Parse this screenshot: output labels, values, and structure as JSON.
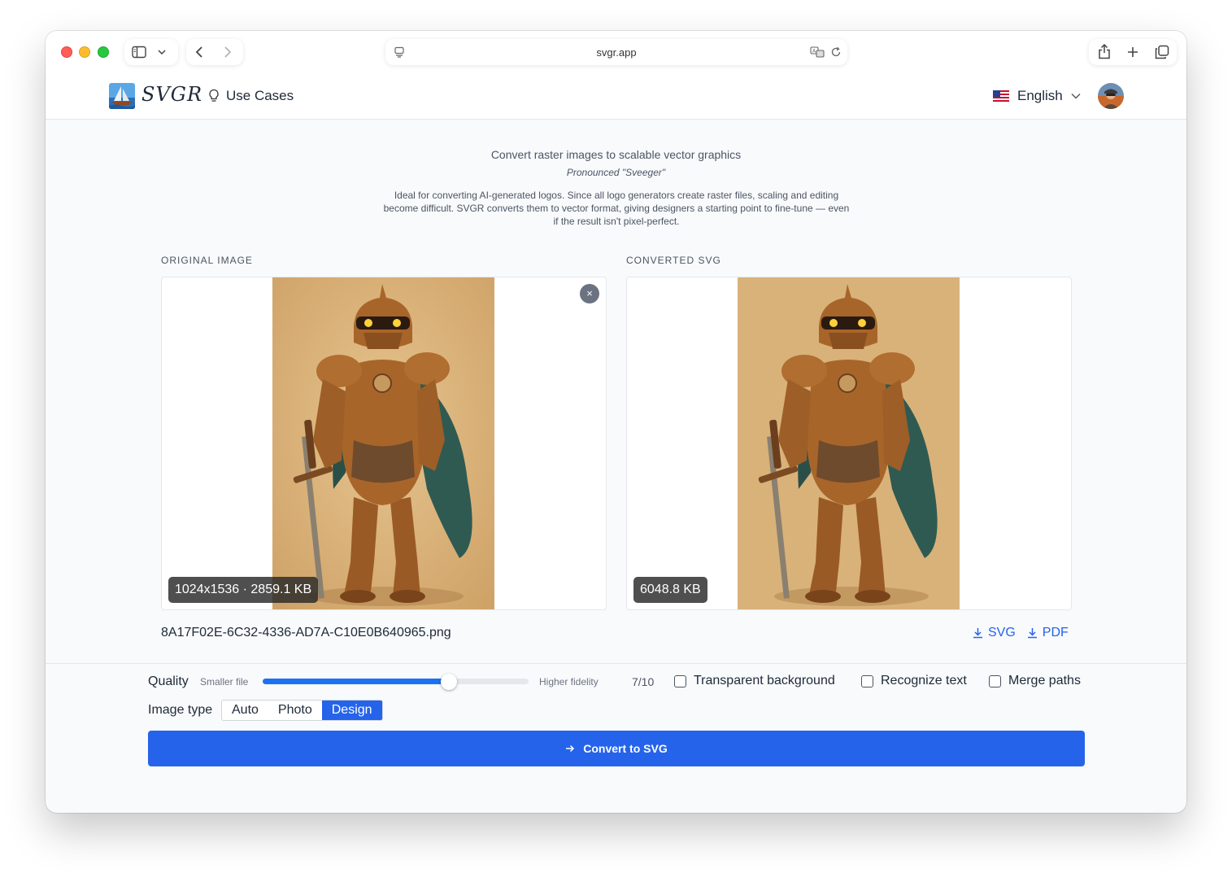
{
  "browser": {
    "url": "svgr.app"
  },
  "header": {
    "logo_text": "SVGR",
    "use_cases": "Use Cases",
    "language": "English"
  },
  "intro": {
    "title": "Convert raster images to scalable vector graphics",
    "pronounced": "Pronounced \"Sveeger\"",
    "description": "Ideal for converting AI-generated logos. Since all logo generators create raster files, scaling and editing become difficult. SVGR converts them to vector format, giving designers a starting point to fine-tune — even if the result isn't pixel-perfect."
  },
  "original": {
    "label": "ORIGINAL IMAGE",
    "badge": "1024x1536 · 2859.1 KB",
    "close": "×",
    "filename": "8A17F02E-6C32-4336-AD7A-C10E0B640965.png"
  },
  "converted": {
    "label": "CONVERTED SVG",
    "badge": "6048.8 KB",
    "download_svg": "SVG",
    "download_pdf": "PDF"
  },
  "controls": {
    "quality_label": "Quality",
    "smaller_file": "Smaller file",
    "higher_fidelity": "Higher fidelity",
    "quality_value": "7/10",
    "quality_fraction": 0.7,
    "transparent_background": "Transparent background",
    "recognize_text": "Recognize text",
    "merge_paths": "Merge paths",
    "image_type_label": "Image type",
    "image_types": [
      "Auto",
      "Photo",
      "Design"
    ],
    "selected_type": "Design",
    "convert_button": "Convert to SVG"
  },
  "colors": {
    "accent": "#2563eb",
    "parchment": "#d9b27a",
    "armor": "#a8652a",
    "cape": "#2f5a52"
  }
}
